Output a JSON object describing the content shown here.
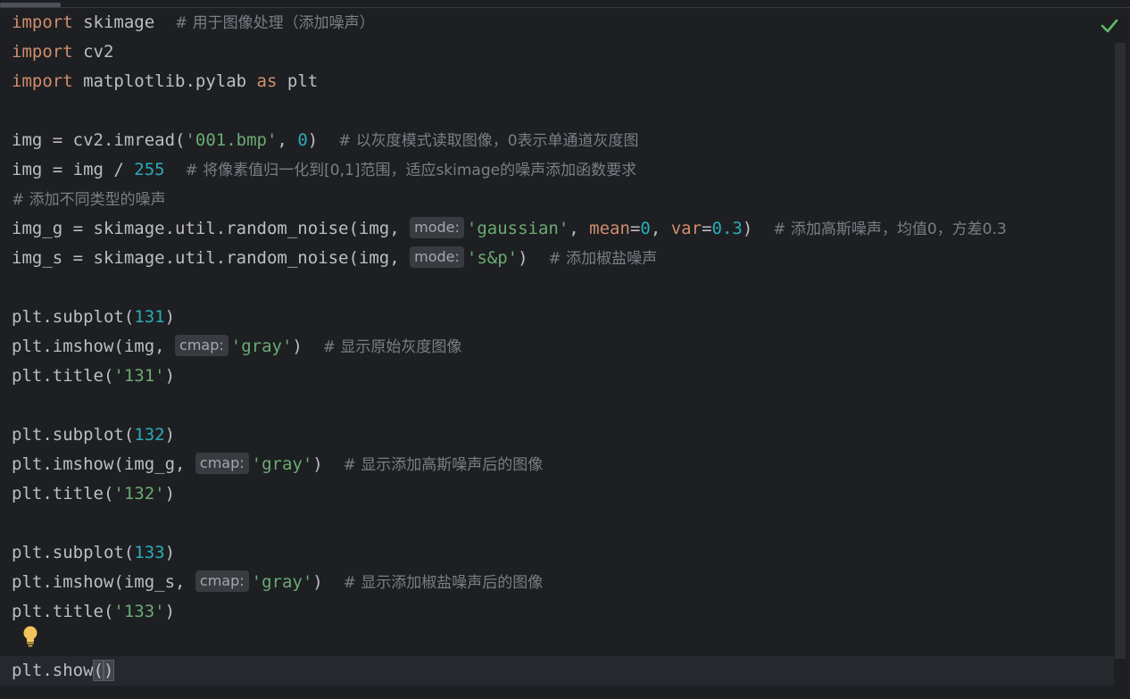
{
  "lines": [
    {
      "l1_kw": "import",
      "l1_mod": " skimage  ",
      "l1_cmt": "# 用于图像处理（添加噪声）"
    },
    {
      "kw": "import",
      "mod": " cv2"
    },
    {
      "kw": "import",
      "mod": " matplotlib.pylab ",
      "as": "as",
      "alias": " plt"
    }
  ],
  "code": {
    "l5_a": "img = cv2.imread(",
    "l5_str": "'001.bmp'",
    "l5_b": ", ",
    "l5_num": "0",
    "l5_c": ")  ",
    "l5_cmt": "# 以灰度模式读取图像，0表示单通道灰度图",
    "l6_a": "img = img / ",
    "l6_num": "255",
    "l6_b": "  ",
    "l6_cmt": "# 将像素值归一化到[0,1]范围，适应skimage的噪声添加函数要求",
    "l7_cmt": "# 添加不同类型的噪声",
    "l8_a": "img_g = skimage.util.random_noise(img, ",
    "l8_hint": "mode:",
    "l8_str": "'gaussian'",
    "l8_b": ", ",
    "l8_p1": "mean",
    "l8_eq1": "=",
    "l8_n1": "0",
    "l8_c": ", ",
    "l8_p2": "var",
    "l8_eq2": "=",
    "l8_n2": "0.3",
    "l8_d": ")  ",
    "l8_cmt": "# 添加高斯噪声，均值0，方差0.3",
    "l9_a": "img_s = skimage.util.random_noise(img, ",
    "l9_hint": "mode:",
    "l9_str": "'s&p'",
    "l9_b": ")  ",
    "l9_cmt": "# 添加椒盐噪声",
    "l11_a": "plt.subplot(",
    "l11_num": "131",
    "l11_b": ")",
    "l12_a": "plt.imshow(img, ",
    "l12_hint": "cmap:",
    "l12_str": "'gray'",
    "l12_b": ")  ",
    "l12_cmt": "# 显示原始灰度图像",
    "l13_a": "plt.title(",
    "l13_str": "'131'",
    "l13_b": ")",
    "l15_a": "plt.subplot(",
    "l15_num": "132",
    "l15_b": ")",
    "l16_a": "plt.imshow(img_g, ",
    "l16_hint": "cmap:",
    "l16_str": "'gray'",
    "l16_b": ")  ",
    "l16_cmt": "# 显示添加高斯噪声后的图像",
    "l17_a": "plt.title(",
    "l17_str": "'132'",
    "l17_b": ")",
    "l19_a": "plt.subplot(",
    "l19_num": "133",
    "l19_b": ")",
    "l20_a": "plt.imshow(img_s, ",
    "l20_hint": "cmap:",
    "l20_str": "'gray'",
    "l20_b": ")  ",
    "l20_cmt": "# 显示添加椒盐噪声后的图像",
    "l21_a": "plt.title(",
    "l21_str": "'133'",
    "l21_b": ")",
    "l23_a": "plt.show",
    "l23_p1": "(",
    "l23_p2": ")"
  },
  "icons": {
    "status": "check-icon",
    "intention": "lightbulb-icon"
  },
  "colors": {
    "background": "#1e1f22",
    "keyword": "#cf8e6d",
    "string": "#6aab73",
    "number": "#2aacb8",
    "comment": "#7a7e85",
    "text": "#bcbec4",
    "check": "#5fb865",
    "bulb": "#f2c55c"
  }
}
